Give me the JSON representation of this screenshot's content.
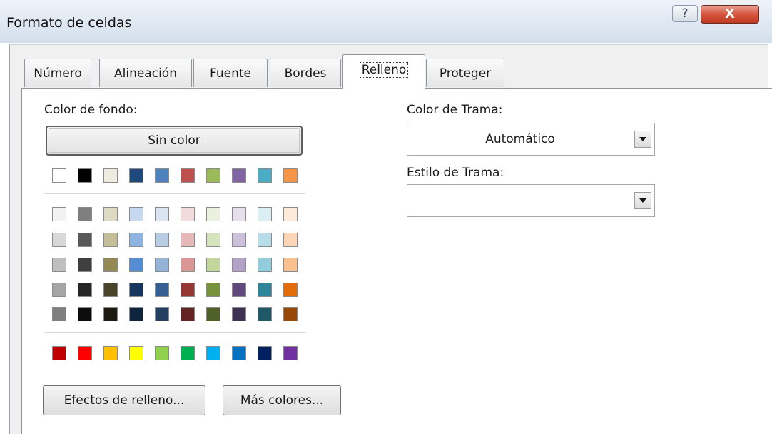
{
  "window": {
    "title": "Formato de celdas",
    "help_label": "?",
    "close_label": "X"
  },
  "tabs": [
    {
      "label": "Número"
    },
    {
      "label": "Alineación"
    },
    {
      "label": "Fuente"
    },
    {
      "label": "Bordes"
    },
    {
      "label": "Relleno",
      "active": true
    },
    {
      "label": "Proteger"
    }
  ],
  "fill": {
    "bg_color_label": "Color de fondo:",
    "no_color_button": "Sin color",
    "theme_row": [
      "#ffffff",
      "#000000",
      "#eeece1",
      "#1f497d",
      "#4f81bd",
      "#c0504d",
      "#9bbb59",
      "#8064a2",
      "#4bacc6",
      "#f79646"
    ],
    "shade_rows": [
      [
        "#f2f2f2",
        "#7f7f7f",
        "#ddd9c3",
        "#c6d9f0",
        "#dbe5f1",
        "#f2dcdb",
        "#ebf1dd",
        "#e5e0ec",
        "#dbeef3",
        "#fdeada"
      ],
      [
        "#d8d8d8",
        "#595959",
        "#c4bd97",
        "#8db3e2",
        "#b8cce4",
        "#e5b9b7",
        "#d7e3bc",
        "#ccc1d9",
        "#b7dde8",
        "#fbd5b5"
      ],
      [
        "#bfbfbf",
        "#3f3f3f",
        "#938953",
        "#548dd4",
        "#95b3d7",
        "#d99694",
        "#c3d69b",
        "#b2a2c7",
        "#92cddc",
        "#fac08f"
      ],
      [
        "#a5a5a5",
        "#262626",
        "#494429",
        "#17365d",
        "#366092",
        "#953734",
        "#76923c",
        "#5f497a",
        "#31859b",
        "#e36c09"
      ],
      [
        "#7f7f7f",
        "#0c0c0c",
        "#1d1b10",
        "#0f243e",
        "#244061",
        "#632423",
        "#4f6128",
        "#3f3151",
        "#205867",
        "#974806"
      ]
    ],
    "standard_row": [
      "#c00000",
      "#ff0000",
      "#ffc000",
      "#ffff00",
      "#92d050",
      "#00b050",
      "#00b0f0",
      "#0070c0",
      "#002060",
      "#7030a0"
    ],
    "fill_effects_button": "Efectos de relleno...",
    "more_colors_button": "Más colores..."
  },
  "pattern": {
    "color_label": "Color de Trama:",
    "color_value": "Automático",
    "style_label": "Estilo de Trama:",
    "style_value": ""
  }
}
